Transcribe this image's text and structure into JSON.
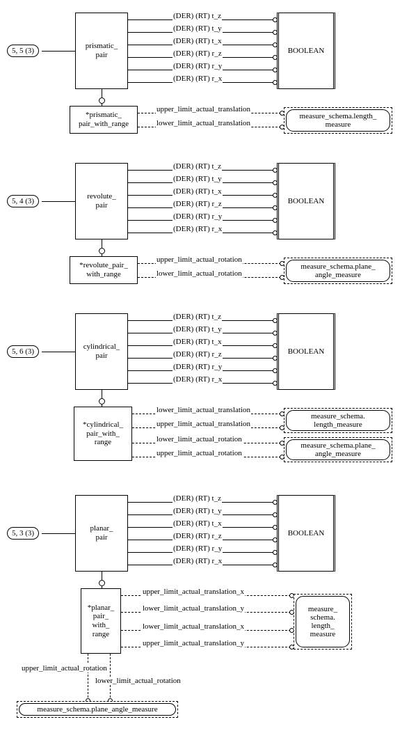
{
  "attrs": [
    "(DER) (RT) t_z",
    "(DER) (RT) t_y",
    "(DER) (RT) t_x",
    "(DER) (RT) r_z",
    "(DER) (RT) r_y",
    "(DER) (RT) r_x"
  ],
  "boolean": "BOOLEAN",
  "s1": {
    "pageref": "5, 5 (3)",
    "entity": "prismatic_\npair",
    "range_entity": "*prismatic_\npair_with_range",
    "range_attrs": [
      "upper_limit_actual_translation",
      "lower_limit_actual_translation"
    ],
    "type": "measure_schema.length_\nmeasure"
  },
  "s2": {
    "pageref": "5, 4 (3)",
    "entity": "revolute_\npair",
    "range_entity": "*revolute_pair_\nwith_range",
    "range_attrs": [
      "upper_limit_actual_rotation",
      "lower_limit_actual_rotation"
    ],
    "type": "measure_schema.plane_\nangle_measure"
  },
  "s3": {
    "pageref": "5, 6 (3)",
    "entity": "cylindrical_\npair",
    "range_entity": "*cylindrical_\npair_with_\nrange",
    "range_attrs": [
      "lower_limit_actual_translation",
      "upper_limit_actual_translation",
      "lower_limit_actual_rotation",
      "upper_limit_actual_rotation"
    ],
    "type1": "measure_schema.\nlength_measure",
    "type2": "measure_schema.plane_\nangle_measure"
  },
  "s4": {
    "pageref": "5, 3 (3)",
    "entity": "planar_\npair",
    "range_entity": "*planar_\npair_\nwith_\nrange",
    "range_attrs": [
      "upper_limit_actual_translation_x",
      "lower_limit_actual_translation_y",
      "lower_limit_actual_translation_x",
      "upper_limit_actual_translation_y"
    ],
    "extra_attrs": [
      "upper_limit_actual_rotation",
      "lower_limit_actual_rotation"
    ],
    "type1": "measure_\nschema.\nlength_\nmeasure",
    "type2": "measure_schema.plane_angle_measure"
  }
}
